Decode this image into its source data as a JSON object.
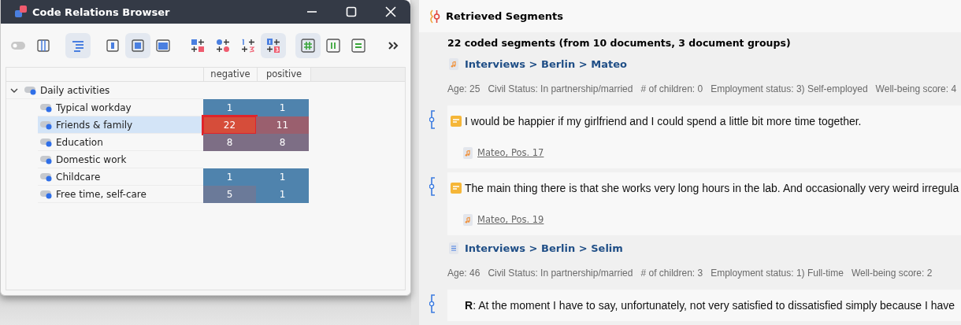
{
  "dialog": {
    "title": "Code Relations Browser",
    "toolbar": [
      {
        "kind": "toggle",
        "selected": false
      },
      {
        "kind": "columns",
        "selected": false
      },
      {
        "kind": "tree",
        "selected": true
      },
      {
        "kind": "square-small",
        "selected": false
      },
      {
        "kind": "square-medium",
        "selected": true
      },
      {
        "kind": "square-large",
        "selected": false
      },
      {
        "kind": "node-square",
        "selected": false
      },
      {
        "kind": "node-dot",
        "selected": false
      },
      {
        "kind": "node-number",
        "selected": false
      },
      {
        "kind": "node-number-box",
        "selected": true
      },
      {
        "kind": "grid",
        "selected": true
      },
      {
        "kind": "pause",
        "selected": false
      },
      {
        "kind": "equals",
        "selected": false
      },
      {
        "kind": "more",
        "selected": false
      }
    ],
    "columns": [
      "negative",
      "positive"
    ],
    "tree": {
      "label": "Daily activities",
      "expanded": true,
      "children": [
        {
          "label": "Typical workday",
          "selected": false,
          "cells": [
            {
              "value": "1",
              "color": "#4f83ad",
              "selected": false
            },
            {
              "value": "1",
              "color": "#4f83ad",
              "selected": false
            }
          ]
        },
        {
          "label": "Friends & family",
          "selected": true,
          "cells": [
            {
              "value": "22",
              "color": "#d64d3a",
              "selected": true
            },
            {
              "value": "11",
              "color": "#9a5f6e",
              "selected": false
            }
          ]
        },
        {
          "label": "Education",
          "selected": false,
          "cells": [
            {
              "value": "8",
              "color": "#7d6e85",
              "selected": false
            },
            {
              "value": "8",
              "color": "#7d6e85",
              "selected": false
            }
          ]
        },
        {
          "label": "Domestic work",
          "selected": false
        },
        {
          "label": "Childcare",
          "selected": false,
          "cells": [
            {
              "value": "1",
              "color": "#4f83ad",
              "selected": false
            },
            {
              "value": "1",
              "color": "#4f83ad",
              "selected": false
            }
          ]
        },
        {
          "label": "Free time, self-care",
          "selected": false,
          "cells": [
            {
              "value": "5",
              "color": "#6b7a99",
              "selected": false
            },
            {
              "value": "1",
              "color": "#4f83ad",
              "selected": false
            }
          ]
        }
      ]
    }
  },
  "retrieved": {
    "title": "Retrieved Segments",
    "summary": "22 coded segments (from 10 documents, 3 document groups)",
    "documents": [
      {
        "kind": "audio",
        "path": "Interviews > Berlin > Mateo",
        "attributes": [
          "Age: 25",
          "Civil Status: In partnership/married",
          "# of children: 0",
          "Employment status: 3) Self-employed",
          "Well-being score: 4"
        ],
        "segments": [
          {
            "text": "I would be happier if my girlfriend and I could spend a little bit more time together.",
            "memo": true,
            "source": "Mateo, Pos. 17"
          },
          {
            "text": "The main thing there is that she works very long hours in the lab. And occasionally very weird irregula",
            "memo": true,
            "source": "Mateo, Pos. 19"
          }
        ]
      },
      {
        "kind": "text",
        "path": "Interviews > Berlin > Selim",
        "attributes": [
          "Age: 46",
          "Civil Status: In partnership/married",
          "# of children: 3",
          "Employment status: 1) Full-time",
          "Well-being score: 2"
        ],
        "segments": [
          {
            "text": "**R**: At the moment I have to say, unfortunately, not very satisfied to dissatisfied simply because I have",
            "memo": false
          }
        ]
      }
    ]
  }
}
